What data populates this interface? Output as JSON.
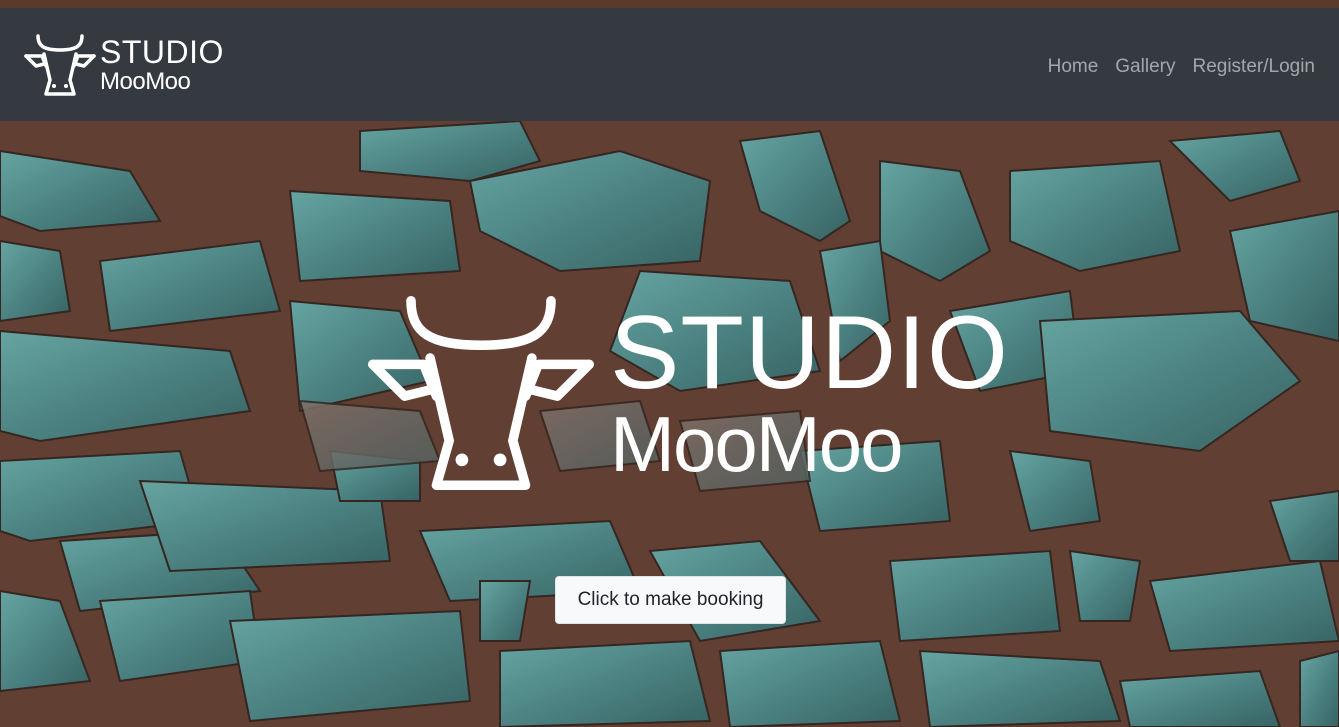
{
  "brand": {
    "line1": "STUDIO",
    "line2": "MooMoo",
    "icon": "cow-head-icon"
  },
  "nav": {
    "items": [
      {
        "label": "Home"
      },
      {
        "label": "Gallery"
      },
      {
        "label": "Register/Login"
      }
    ]
  },
  "hero": {
    "logo_line1": "STUDIO",
    "logo_line2": "MooMoo",
    "booking_button": "Click to make booking"
  },
  "colors": {
    "navbar": "#343a40",
    "nav_link": "#8c8f93",
    "button_bg": "#f8f9fa",
    "stone": "#4f8a8a",
    "mortar": "#6b4538"
  }
}
